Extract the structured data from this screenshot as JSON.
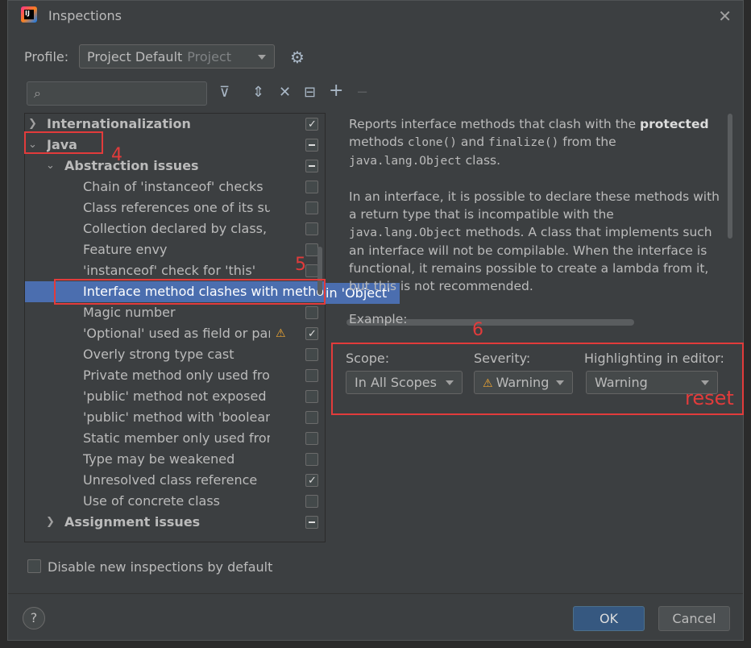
{
  "window": {
    "title": "Inspections",
    "close_icon": "✕"
  },
  "profile": {
    "label": "Profile:",
    "value": "Project Default",
    "scope": "Project"
  },
  "toolbar": {
    "filter": "⊽",
    "expand": "⇕",
    "collapse": "✕",
    "reset": "⊟",
    "add": "+",
    "remove": "−"
  },
  "tree": {
    "rows": [
      {
        "label": "Internationalization",
        "check": "checked"
      },
      {
        "label": "Java",
        "check": "partial"
      },
      {
        "label": "Abstraction issues",
        "check": "partial"
      },
      {
        "label": "Chain of 'instanceof' checks",
        "check": "off"
      },
      {
        "label": "Class references one of its subclasses",
        "check": "off"
      },
      {
        "label": "Collection declared by class, not interface",
        "check": "off"
      },
      {
        "label": "Feature envy",
        "check": "off"
      },
      {
        "label": "'instanceof' check for 'this'",
        "check": "off"
      },
      {
        "label": "Interface method clashes with method in 'Object'",
        "check": "none",
        "selected": true
      },
      {
        "label": "Magic number",
        "check": "off"
      },
      {
        "label": "'Optional' used as field or parameter type",
        "check": "checked",
        "warning": true
      },
      {
        "label": "Overly strong type cast",
        "check": "off"
      },
      {
        "label": "Private method only used from inner class",
        "check": "off"
      },
      {
        "label": "'public' method not exposed in interface",
        "check": "off"
      },
      {
        "label": "'public' method with 'boolean' parameter",
        "check": "off"
      },
      {
        "label": "Static member only used from one other class",
        "check": "off"
      },
      {
        "label": "Type may be weakened",
        "check": "off"
      },
      {
        "label": "Unresolved class reference",
        "check": "checked"
      },
      {
        "label": "Use of concrete class",
        "check": "off"
      },
      {
        "label": "Assignment issues",
        "check": "partial"
      }
    ]
  },
  "description": {
    "p1_a": "Reports interface methods that clash with the ",
    "p1_b": "protected",
    "p1_c": " methods ",
    "p1_clone": "clone()",
    "p1_and": " and ",
    "p1_finalize": "finalize()",
    "p1_from": " from the ",
    "p1_object": "java.lang.Object",
    "p1_end": " class.",
    "p2_a": "In an interface, it is possible to declare these methods with a return type that is incompatible with the ",
    "p2_object": "java.lang.Object",
    "p2_b": " methods. A class that implements such an interface will not be compilable. When the interface is functional, it remains possible to create a lambda from it, but this is not recommended.",
    "example": "Example:"
  },
  "options": {
    "scope_label": "Scope:",
    "scope_value": "In All Scopes",
    "severity_label": "Severity:",
    "severity_value": "Warning",
    "highlight_label": "Highlighting in editor:",
    "highlight_value": "Warning"
  },
  "annotations": {
    "a4": "4",
    "a5": "5",
    "a6": "6",
    "reset": "reset"
  },
  "footer": {
    "disable_label": "Disable new inspections by default",
    "help": "?",
    "ok": "OK",
    "cancel": "Cancel"
  }
}
